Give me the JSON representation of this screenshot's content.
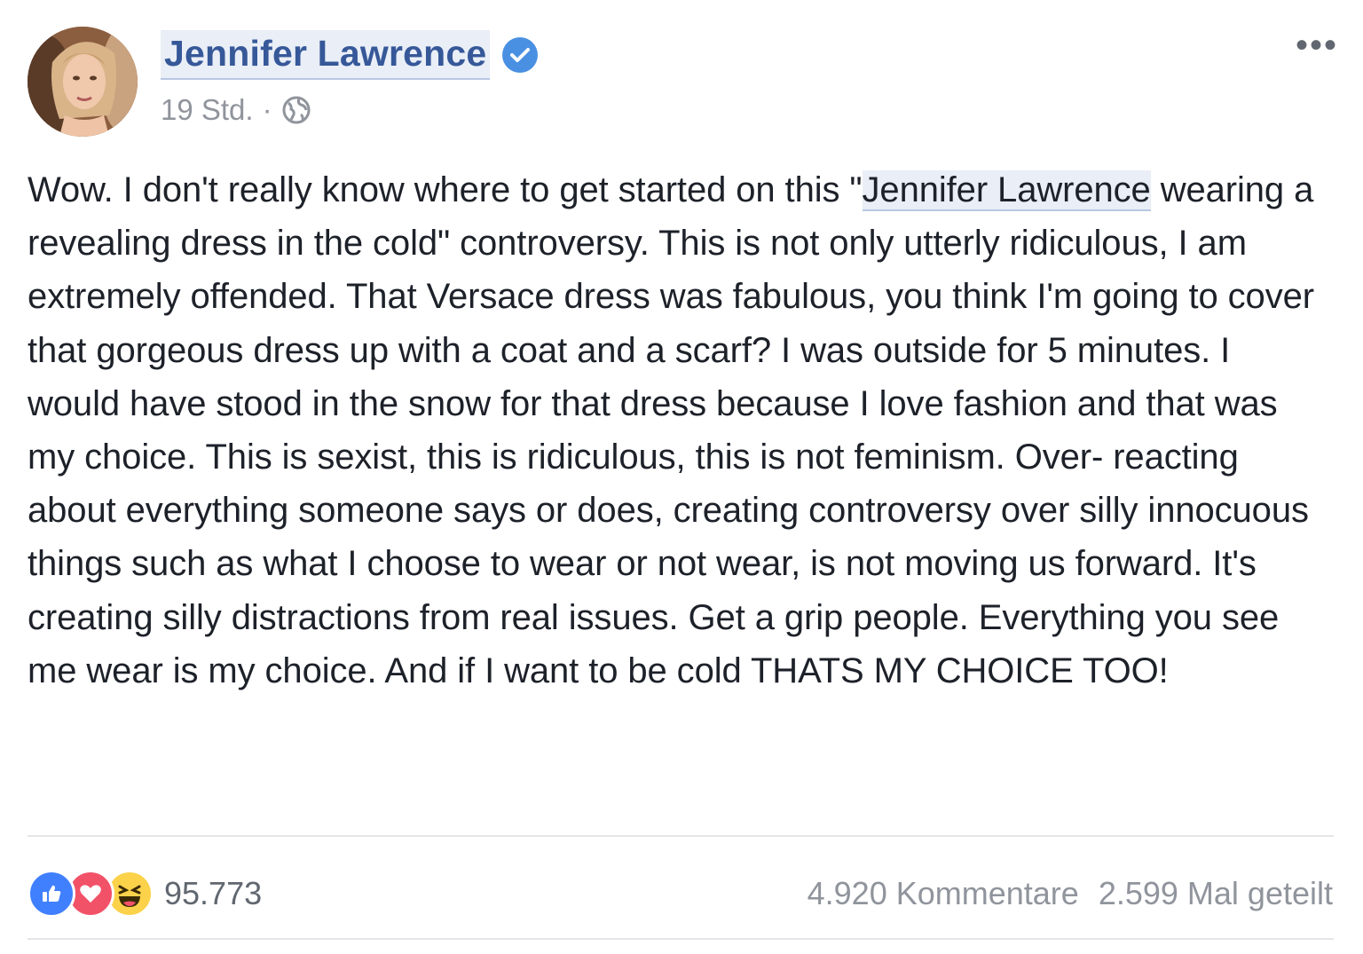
{
  "post": {
    "author": "Jennifer Lawrence",
    "timestamp": "19 Std.",
    "separator": "·",
    "audience_icon": "globe-icon",
    "more_label": "•••",
    "text_before_highlight": "Wow. I don't really know where to get started on this \"",
    "text_highlight": "Jennifer Lawrence",
    "text_after_highlight": " wearing a revealing dress in the cold\" controversy. This is not only utterly ridiculous, I am extremely offended. That Versace dress was fabulous, you think I'm going to cover that gorgeous dress up with a coat and a scarf? I was outside for 5 minutes. I would have stood in the snow for that dress because I love fashion and that was my choice. This is sexist, this is ridiculous, this is not feminism. Over- reacting about everything someone says or does, creating controversy over silly innocuous things such as what I choose to wear or not wear, is not moving us forward. It's creating silly distractions from real issues. Get a grip people. Everything you see me wear is my choice. And if I want to be cold THATS MY CHOICE TOO!"
  },
  "footer": {
    "reaction_icons": [
      "like-icon",
      "love-icon",
      "haha-icon"
    ],
    "reaction_count": "95.773",
    "comments": "4.920 Kommentare",
    "shares": "2.599 Mal geteilt"
  },
  "colors": {
    "link": "#365899",
    "link_highlight": "#e9eef7",
    "verified": "#4a90e2",
    "meta": "#90949c",
    "like": "#4080ff",
    "love": "#f25268",
    "haha": "#fcd24a"
  }
}
